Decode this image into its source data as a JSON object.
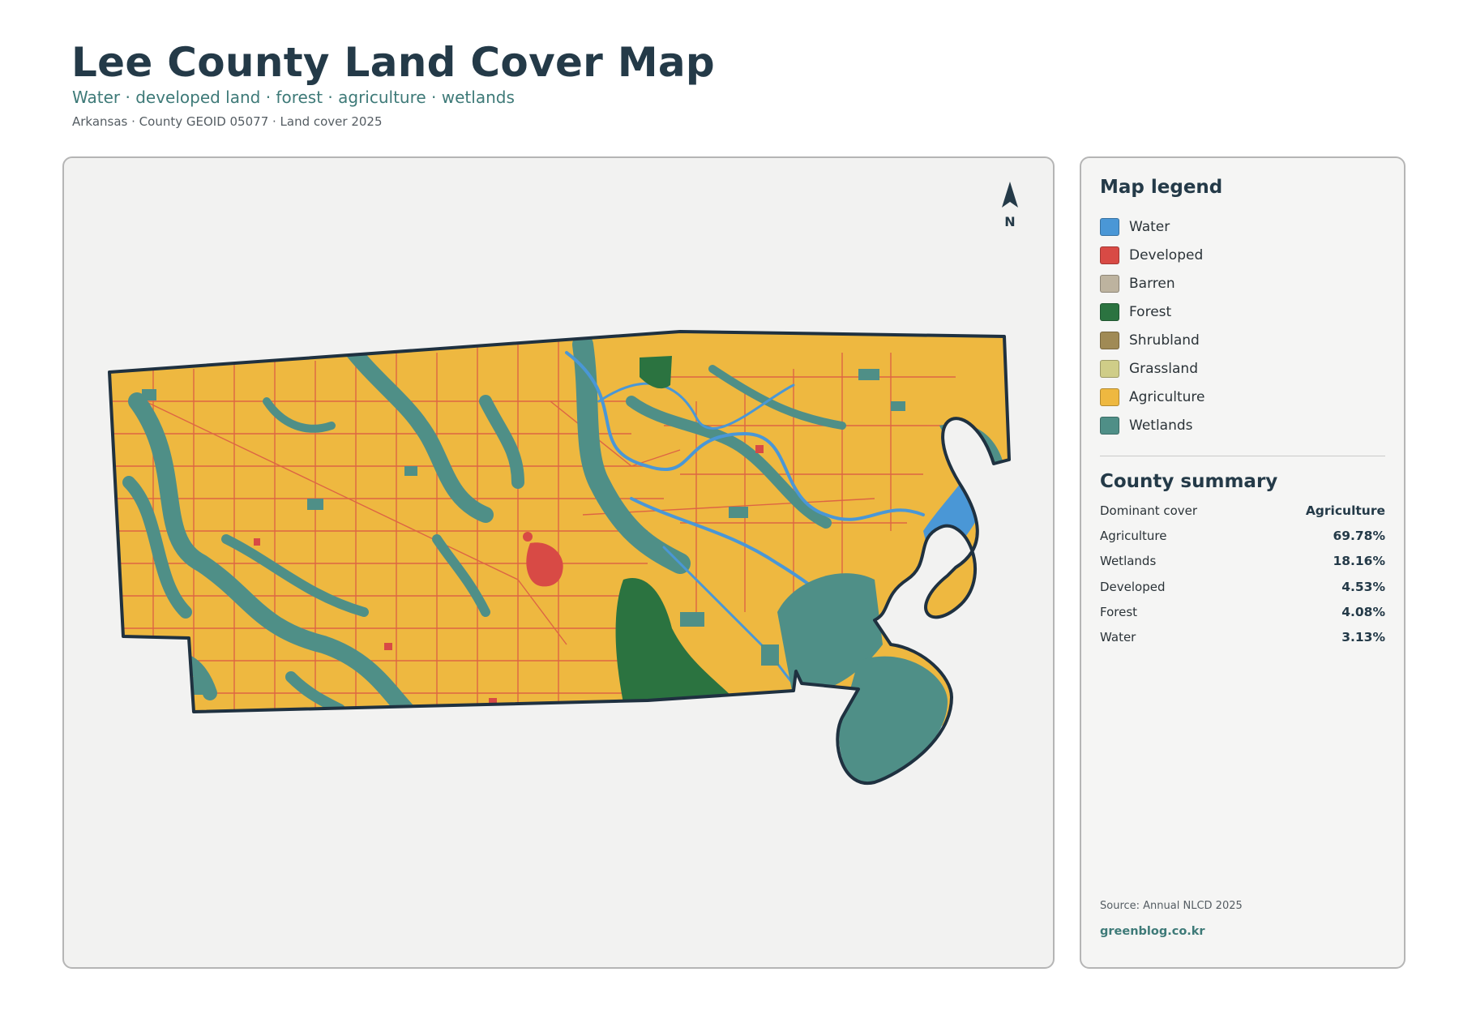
{
  "header": {
    "title": "Lee County Land Cover Map",
    "subtitle": "Water · developed land · forest · agriculture · wetlands",
    "meta": "Arkansas · County GEOID 05077 · Land cover 2025"
  },
  "map": {
    "north_label": "N"
  },
  "legend": {
    "title": "Map legend",
    "items": [
      {
        "label": "Water",
        "color": "#4a97d6"
      },
      {
        "label": "Developed",
        "color": "#d84a45"
      },
      {
        "label": "Barren",
        "color": "#bdb39f"
      },
      {
        "label": "Forest",
        "color": "#2b7340"
      },
      {
        "label": "Shrubland",
        "color": "#a08a55"
      },
      {
        "label": "Grassland",
        "color": "#cfcd88"
      },
      {
        "label": "Agriculture",
        "color": "#eeb840"
      },
      {
        "label": "Wetlands",
        "color": "#4f8f87"
      }
    ]
  },
  "summary": {
    "title": "County summary",
    "rows": [
      {
        "label": "Dominant cover",
        "value": "Agriculture"
      },
      {
        "label": "Agriculture",
        "value": "69.78%"
      },
      {
        "label": "Wetlands",
        "value": "18.16%"
      },
      {
        "label": "Developed",
        "value": "4.53%"
      },
      {
        "label": "Forest",
        "value": "4.08%"
      },
      {
        "label": "Water",
        "value": "3.13%"
      }
    ]
  },
  "footer": {
    "source": "Source: Annual NLCD 2025",
    "site": "greenblog.co.kr"
  }
}
